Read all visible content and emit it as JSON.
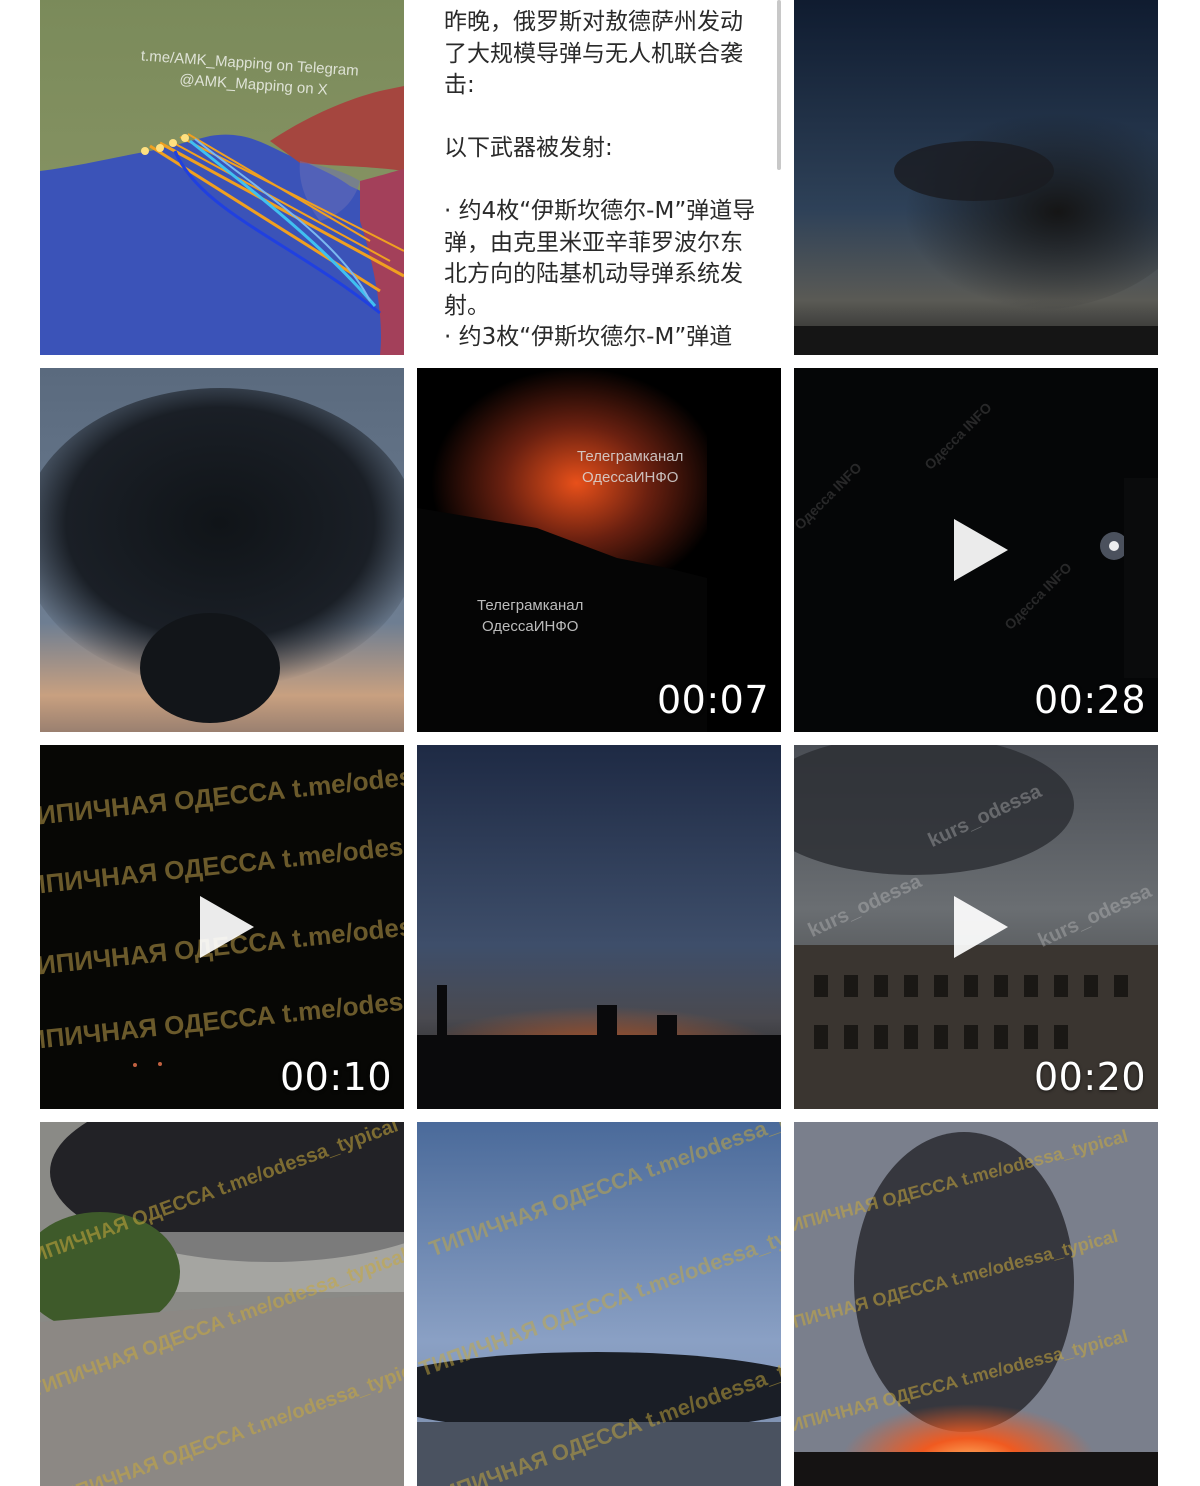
{
  "grid": {
    "tiles": [
      {
        "id": "map",
        "kind": "image",
        "watermark_lines": [
          "t.me/AMK_Mapping on Telegram",
          "@AMK_Mapping  on X"
        ]
      },
      {
        "id": "text",
        "kind": "text"
      },
      {
        "id": "smoke-dusk",
        "kind": "image"
      },
      {
        "id": "smoke-cloud",
        "kind": "image"
      },
      {
        "id": "fire-night",
        "kind": "video",
        "duration": "00:07",
        "watermark_lines": [
          "Телеграмканал",
          "ОдессаИНФО"
        ]
      },
      {
        "id": "night-dark",
        "kind": "video",
        "duration": "00:28",
        "watermark_text": "Одесса INFO"
      },
      {
        "id": "typical-dark",
        "kind": "video",
        "duration": "00:10",
        "watermark_text": "ТИПИЧНАЯ ОДЕССА  t.me/odessa_typical"
      },
      {
        "id": "city-glow",
        "kind": "image"
      },
      {
        "id": "building-smoke",
        "kind": "video",
        "duration": "00:20",
        "watermark_text": "kurs_odessa"
      },
      {
        "id": "road-smoke",
        "kind": "image",
        "watermark_text": "ТИПИЧНАЯ ОДЕССА  t.me/odessa_typical"
      },
      {
        "id": "sky-smoke",
        "kind": "image",
        "watermark_text": "ТИПИЧНАЯ ОДЕССА  t.me/odessa_typical"
      },
      {
        "id": "fire-ground",
        "kind": "image",
        "watermark_text": "ТИПИЧНАЯ ОДЕССА  t.me/odessa_typical"
      }
    ]
  },
  "post": {
    "paragraphs": [
      "昨晚，俄罗斯对敖德萨州发动了大规模导弹与无人机联合袭击:",
      "以下武器被发射:",
      "· 约4枚“伊斯坎德尔-M”弹道导弹，由克里米亚辛菲罗波尔东北方向的陆基机动导弹系统发射。",
      "· 约3枚“伊斯坎德尔-M”弹道"
    ]
  },
  "fire_tile": {
    "watermark_1": [
      "Телеграмканал",
      "ОдессаИНФО"
    ],
    "watermark_2": [
      "Телеграмканал",
      "ОдессаИНФО"
    ]
  },
  "icons": {
    "play": "play-icon"
  },
  "colors": {
    "background": "#ffffff",
    "duration_text": "#ffffff"
  }
}
